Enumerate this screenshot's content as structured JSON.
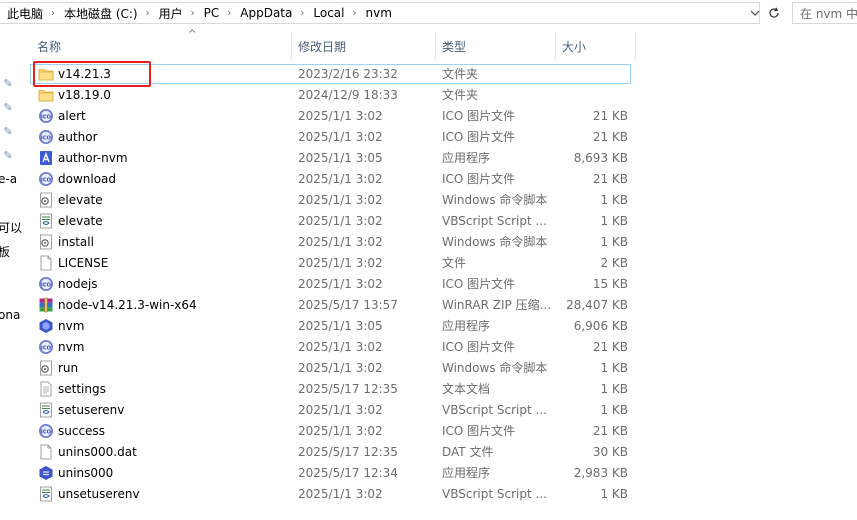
{
  "address": {
    "crumbs": [
      "此电脑",
      "本地磁盘 (C:)",
      "用户",
      "PC",
      "AppData",
      "Local",
      "nvm"
    ],
    "search_placeholder": "在 nvm 中"
  },
  "nav_fragments": [
    "e-a",
    "可以",
    "板",
    "ona"
  ],
  "columns": {
    "name": "名称",
    "modified": "修改日期",
    "type": "类型",
    "size": "大小"
  },
  "files": [
    {
      "name": "v14.21.3",
      "modified": "2023/2/16 23:32",
      "type": "文件夹",
      "size": "",
      "icon": "folder-icon"
    },
    {
      "name": "v18.19.0",
      "modified": "2024/12/9 18:33",
      "type": "文件夹",
      "size": "",
      "icon": "folder-icon"
    },
    {
      "name": "alert",
      "modified": "2025/1/1 3:02",
      "type": "ICO 图片文件",
      "size": "21 KB",
      "icon": "ico-file-icon"
    },
    {
      "name": "author",
      "modified": "2025/1/1 3:02",
      "type": "ICO 图片文件",
      "size": "21 KB",
      "icon": "ico-file-icon"
    },
    {
      "name": "author-nvm",
      "modified": "2025/1/1 3:05",
      "type": "应用程序",
      "size": "8,693 KB",
      "icon": "app-icon"
    },
    {
      "name": "download",
      "modified": "2025/1/1 3:02",
      "type": "ICO 图片文件",
      "size": "21 KB",
      "icon": "ico-file-icon"
    },
    {
      "name": "elevate",
      "modified": "2025/1/1 3:02",
      "type": "Windows 命令脚本",
      "size": "1 KB",
      "icon": "cmd-script-icon"
    },
    {
      "name": "elevate",
      "modified": "2025/1/1 3:02",
      "type": "VBScript Script ...",
      "size": "1 KB",
      "icon": "vbscript-icon"
    },
    {
      "name": "install",
      "modified": "2025/1/1 3:02",
      "type": "Windows 命令脚本",
      "size": "1 KB",
      "icon": "cmd-script-icon"
    },
    {
      "name": "LICENSE",
      "modified": "2025/1/1 3:02",
      "type": "文件",
      "size": "2 KB",
      "icon": "blank-file-icon"
    },
    {
      "name": "nodejs",
      "modified": "2025/1/1 3:02",
      "type": "ICO 图片文件",
      "size": "15 KB",
      "icon": "ico-file-icon"
    },
    {
      "name": "node-v14.21.3-win-x64",
      "modified": "2025/5/17 13:57",
      "type": "WinRAR ZIP 压缩...",
      "size": "28,407 KB",
      "icon": "winrar-zip-icon"
    },
    {
      "name": "nvm",
      "modified": "2025/1/1 3:05",
      "type": "应用程序",
      "size": "6,906 KB",
      "icon": "nvm-app-icon"
    },
    {
      "name": "nvm",
      "modified": "2025/1/1 3:02",
      "type": "ICO 图片文件",
      "size": "21 KB",
      "icon": "ico-file-icon"
    },
    {
      "name": "run",
      "modified": "2025/1/1 3:02",
      "type": "Windows 命令脚本",
      "size": "1 KB",
      "icon": "cmd-script-icon"
    },
    {
      "name": "settings",
      "modified": "2025/5/17 12:35",
      "type": "文本文档",
      "size": "1 KB",
      "icon": "text-file-icon"
    },
    {
      "name": "setuserenv",
      "modified": "2025/1/1 3:02",
      "type": "VBScript Script ...",
      "size": "1 KB",
      "icon": "vbscript-icon"
    },
    {
      "name": "success",
      "modified": "2025/1/1 3:02",
      "type": "ICO 图片文件",
      "size": "21 KB",
      "icon": "ico-file-icon"
    },
    {
      "name": "unins000.dat",
      "modified": "2025/5/17 12:35",
      "type": "DAT 文件",
      "size": "30 KB",
      "icon": "blank-file-icon"
    },
    {
      "name": "unins000",
      "modified": "2025/5/17 12:34",
      "type": "应用程序",
      "size": "2,983 KB",
      "icon": "installer-icon"
    },
    {
      "name": "unsetuserenv",
      "modified": "2025/1/1 3:02",
      "type": "VBScript Script ...",
      "size": "1 KB",
      "icon": "vbscript-icon"
    }
  ],
  "colors": {
    "header_text": "#4c607a",
    "meta_text": "#6d6d6d",
    "selection_border": "#99d1ff",
    "annotation_red": "#e8201e",
    "folder_yellow": "#f8d775"
  }
}
